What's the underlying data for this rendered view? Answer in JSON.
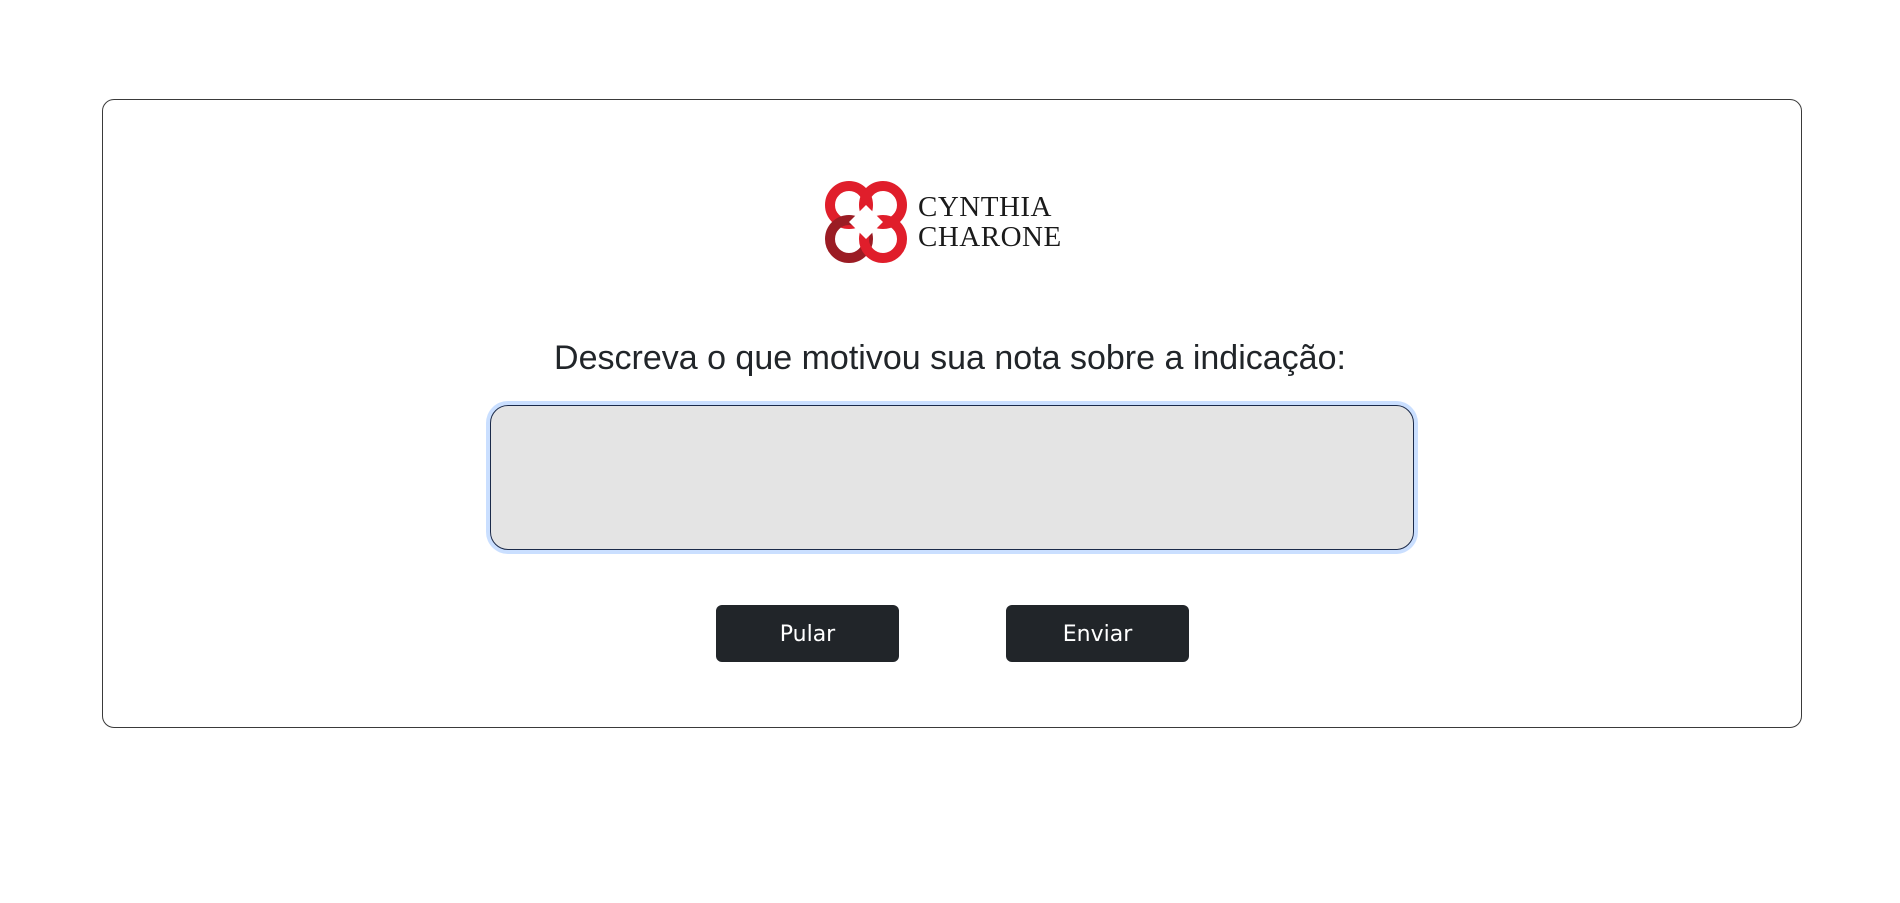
{
  "brand": {
    "name_line1": "CYNTHIA",
    "name_line2": "CHARONE",
    "logo_icon": "interlocked-rings-logo-icon",
    "colors": {
      "primary_red": "#e01e2b",
      "dark_red": "#9b1c24"
    }
  },
  "form": {
    "prompt": "Descreva o que motivou sua nota sobre a indicação:",
    "comment_value": "",
    "comment_placeholder": ""
  },
  "actions": {
    "skip_label": "Pular",
    "send_label": "Enviar"
  },
  "theme": {
    "button_bg": "#212529",
    "textarea_bg": "#e4e4e4",
    "focus_ring": "#bcd3f5"
  }
}
